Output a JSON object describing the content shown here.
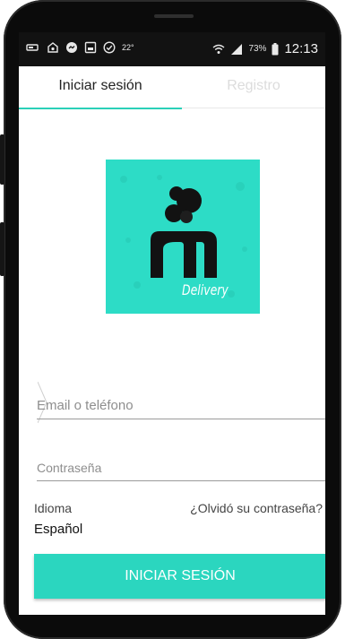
{
  "status_bar": {
    "temperature": "22°",
    "battery_percent": "73%",
    "time": "12:13",
    "left_icons": [
      "cast-icon",
      "photo-icon",
      "messenger-icon",
      "gallery-icon",
      "check-circle-icon"
    ],
    "right_icons": [
      "wifi-icon",
      "signal-icon",
      "battery-icon"
    ]
  },
  "tabs": [
    {
      "label": "Iniciar sesión",
      "active": true
    },
    {
      "label": "Registro",
      "active": false
    }
  ],
  "logo": {
    "word": "Delivery",
    "background": "#2ddcc6"
  },
  "form": {
    "email_placeholder": "Email o teléfono",
    "password_placeholder": "Contraseña",
    "language_label": "Idioma",
    "language_value": "Español",
    "forgot_password": "¿Olvidó su contraseña?",
    "submit_label": "INICIAR SESIÓN"
  },
  "colors": {
    "accent": "#2bd6bf",
    "tab_inactive": "#dcdcdc",
    "status_bar": "#121212"
  }
}
